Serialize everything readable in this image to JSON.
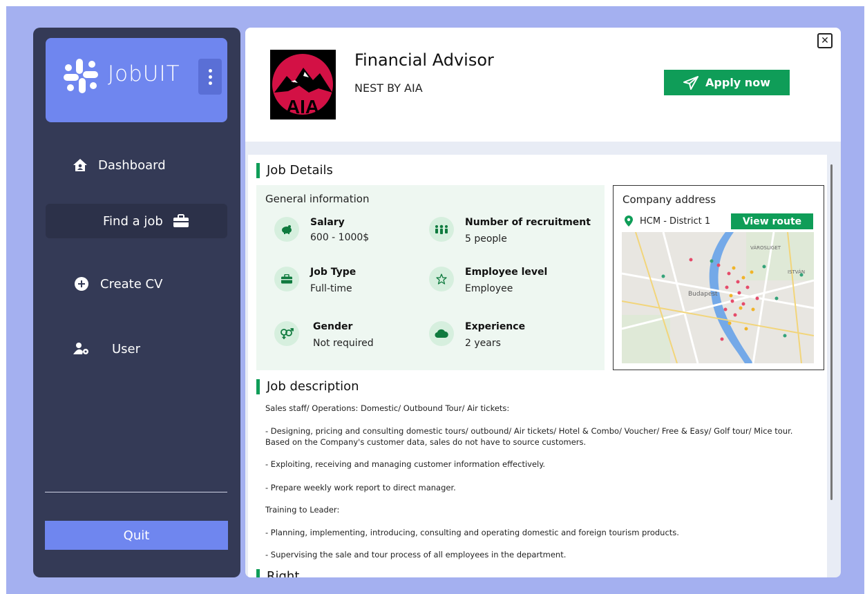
{
  "app": {
    "name": "JobUIT"
  },
  "sidebar": {
    "items": [
      {
        "label": "Dashboard",
        "icon": "home-icon"
      },
      {
        "label": "Find a job",
        "icon": "briefcase-icon"
      },
      {
        "label": "Create CV",
        "icon": "plus-circle-icon"
      },
      {
        "label": "User",
        "icon": "user-gear-icon"
      }
    ],
    "quit_label": "Quit"
  },
  "job": {
    "title": "Financial Advisor",
    "company": "NEST BY AIA",
    "apply_label": "Apply now",
    "logo_text": "AIA"
  },
  "details": {
    "title": "Job Details",
    "general_title": "General information",
    "fields": [
      {
        "label": "Salary",
        "value": "600 - 1000$",
        "icon": "piggy-bank-icon"
      },
      {
        "label": "Number of recruitment",
        "value": "5 people",
        "icon": "people-icon"
      },
      {
        "label": "Job Type",
        "value": "Full-time",
        "icon": "briefcase-icon"
      },
      {
        "label": "Employee level",
        "value": "Employee",
        "icon": "star-icon"
      },
      {
        "label": "Gender",
        "value": "Not required",
        "icon": "gender-icon"
      },
      {
        "label": "Experience",
        "value": "2 years",
        "icon": "cloud-icon"
      }
    ]
  },
  "address": {
    "title": "Company address",
    "location": "HCM - District 1",
    "route_label": "View route",
    "map_labels": [
      "Budapest",
      "VÁROSLIGET",
      "ISTVÁN"
    ]
  },
  "description": {
    "title": "Job description",
    "lines": [
      "Sales staff/ Operations: Domestic/ Outbound Tour/ Air tickets:",
      "- Designing, pricing and consulting domestic tours/ outbound/ Air tickets/ Hotel & Combo/ Voucher/ Free & Easy/ Golf tour/ Mice tour.",
      "Based on the Company's customer data, sales do not have to source customers.",
      "- Exploiting, receiving and managing customer information effectively.",
      "- Prepare weekly work report to direct manager.",
      "Training to Leader:",
      "- Planning, implementing, introducing, consulting and operating domestic and foreign tourism products.",
      "- Supervising the sale and tour process of all employees in the department."
    ]
  },
  "right": {
    "title": "Right"
  },
  "colors": {
    "accent": "#0f9d58",
    "sidebar": "#343a56",
    "brand": "#6f86ef",
    "background": "#a4b0f0"
  }
}
